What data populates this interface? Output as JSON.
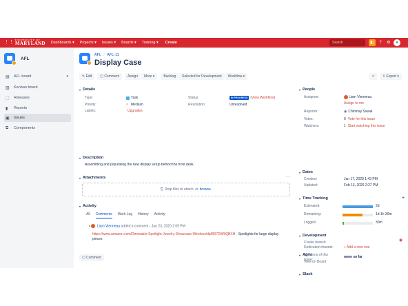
{
  "topbar": {
    "logo_line1": "UNIVERSITY OF",
    "logo_line2": "MARYLAND",
    "nav": [
      "Dashboards ▾",
      "Projects ▾",
      "Issues ▾",
      "Boards ▾",
      "Training ▾"
    ],
    "create": "Create",
    "search_placeholder": "Search"
  },
  "sidebar": {
    "project_name": "AFL",
    "items": [
      {
        "label": "AFL board",
        "icon": "board-icon"
      },
      {
        "label": "Kanban board",
        "icon": "board-icon"
      },
      {
        "label": "Releases",
        "icon": "ship-icon"
      },
      {
        "label": "Reports",
        "icon": "chart-icon"
      },
      {
        "label": "Issues",
        "icon": "issues-icon"
      },
      {
        "label": "Components",
        "icon": "components-icon"
      }
    ]
  },
  "issue": {
    "breadcrumb_project": "AFL",
    "breadcrumb_sep": "/",
    "breadcrumb_key": "AFL-11",
    "title": "Display Case"
  },
  "toolbar": {
    "edit": "✎ Edit",
    "comment": "▢ Comment",
    "assign": "Assign",
    "more": "More ▾",
    "backlog": "Backlog",
    "selected": "Selected for Development",
    "workflow": "Workflow ▾",
    "share": "<",
    "export": "⇪ Export ▾"
  },
  "details": {
    "heading": "Details",
    "type_label": "Type:",
    "type_value": "Task",
    "priority_label": "Priority:",
    "priority_value": "Medium",
    "labels_label": "Labels:",
    "labels_value": "Upgrades",
    "status_label": "Status:",
    "status_value": "IN PROGRESS",
    "status_link": "(View Workflow)",
    "resolution_label": "Resolution:",
    "resolution_value": "Unresolved"
  },
  "description": {
    "heading": "Description",
    "text": "Assembling and populating the new display setup behind the front desk"
  },
  "attachments": {
    "heading": "Attachments",
    "drop_text": "Drop files to attach, or",
    "browse": "browse."
  },
  "activity": {
    "heading": "Activity",
    "tabs": [
      "All",
      "Comments",
      "Work Log",
      "History",
      "Activity"
    ],
    "comment_author": "Liam Vienneau",
    "comment_meta": "added a comment - Jan 23, 2020 2:09 PM",
    "comment_link": "https://www.amazon.com/Dimmable-Spotlight-Jewelry-Showcase-Wireless/dp/B07DW5QBXH",
    "comment_tail": " - Spotlights for large display pieces",
    "comment_button": "▢ Comment"
  },
  "people": {
    "heading": "People",
    "assignee_label": "Assignee:",
    "assignee_value": "Liam Vienneau",
    "assign_me": "Assign to me",
    "reporter_label": "Reporter:",
    "reporter_value": "Chinmay Savak",
    "votes_label": "Votes:",
    "votes_value": "Vote for this issue",
    "votes_count": "0",
    "watchers_label": "Watchers:",
    "watchers_value": "Start watching this issue",
    "watchers_count": "1"
  },
  "dates": {
    "heading": "Dates",
    "created_label": "Created:",
    "created_value": "Jan 17, 2020 1:43 PM",
    "updated_label": "Updated:",
    "updated_value": "Feb 13, 2020 2:27 PM"
  },
  "time_tracking": {
    "heading": "Time Tracking",
    "estimated_label": "Estimated:",
    "estimated_value": "2d",
    "estimated_fill": 1.0,
    "remaining_label": "Remaining:",
    "remaining_value": "1d 1h 30m",
    "remaining_fill": 0.65,
    "logged_label": "Logged:",
    "logged_value": "30m",
    "logged_fill": 0.04,
    "colors": {
      "estimated": "#4a9ae1",
      "remaining": "#ec8e00",
      "logged": "#51a825"
    }
  },
  "development": {
    "heading": "Development",
    "link": "Create branch"
  },
  "agile": {
    "heading": "Agile",
    "link": "View on Board"
  },
  "slack": {
    "heading": "Slack",
    "channel_label": "Dedicated channel:",
    "channel_value": "+ Add a new one",
    "mentions_label": "Mentions of this issue:",
    "mentions_value": "none so far"
  }
}
